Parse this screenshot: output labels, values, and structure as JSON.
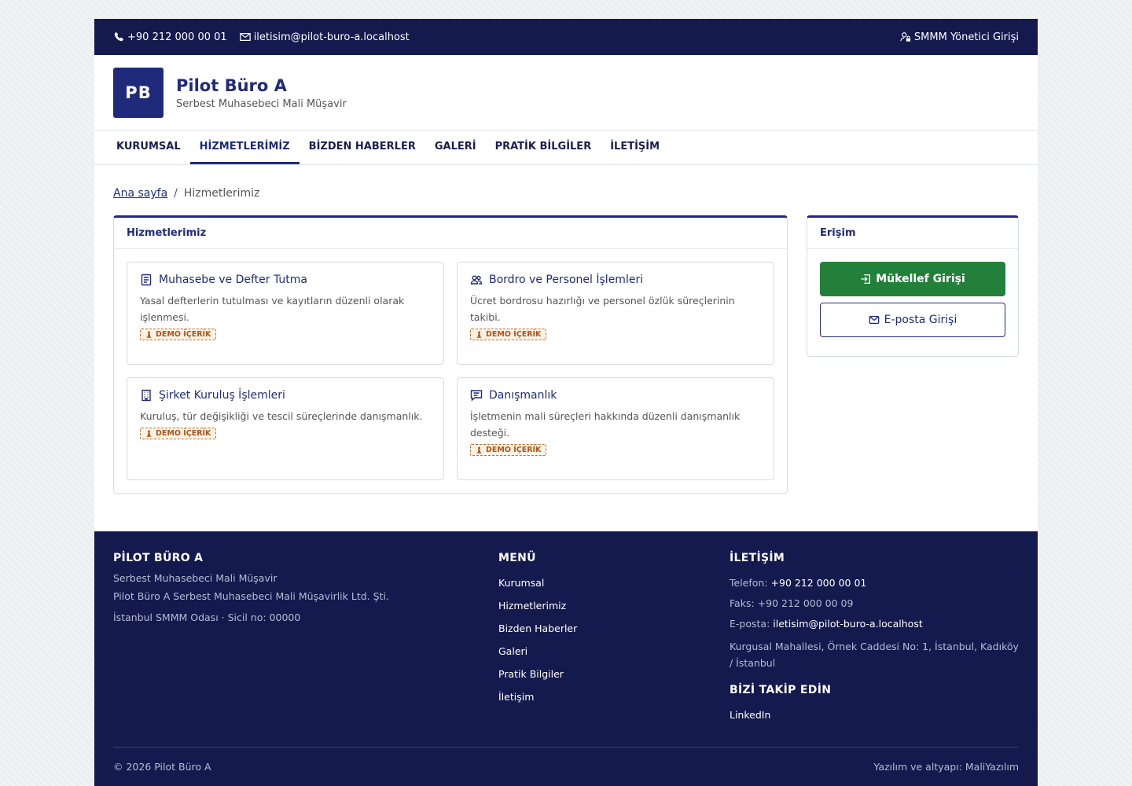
{
  "topbar": {
    "phone": "+90 212 000 00 01",
    "email": "iletisim@pilot-buro-a.localhost",
    "admin_login": "SMMM Yönetici Girişi"
  },
  "header": {
    "logo": "PB",
    "name": "Pilot Büro A",
    "subtitle": "Serbest Muhasebeci Mali Müşavir"
  },
  "nav": {
    "items": [
      {
        "label": "KURUMSAL"
      },
      {
        "label": "HİZMETLERİMİZ",
        "active": true
      },
      {
        "label": "BİZDEN HABERLER"
      },
      {
        "label": "GALERİ"
      },
      {
        "label": "PRATİK BİLGİLER"
      },
      {
        "label": "İLETİŞİM"
      }
    ]
  },
  "breadcrumb": {
    "home": "Ana sayfa",
    "separator": "/",
    "current": "Hizmetlerimiz"
  },
  "services": {
    "title": "Hizmetlerimiz",
    "demo_label": "DEMO İÇERİK",
    "cards": [
      {
        "icon": "ledger-icon",
        "title": "Muhasebe ve Defter Tutma",
        "desc": "Yasal defterlerin tutulması ve kayıtların düzenli olarak işlenmesi."
      },
      {
        "icon": "people-icon",
        "title": "Bordro ve Personel İşlemleri",
        "desc": "Ücret bordrosu hazırlığı ve personel özlük süreçlerinin takibi."
      },
      {
        "icon": "building-icon",
        "title": "Şirket Kuruluş İşlemleri",
        "desc": "Kuruluş, tür değişikliği ve tescil süreçlerinde danışmanlık."
      },
      {
        "icon": "chat-icon",
        "title": "Danışmanlık",
        "desc": "İşletmenin mali süreçleri hakkında düzenli danışmanlık desteği."
      }
    ]
  },
  "access": {
    "title": "Erişim",
    "primary": "Mükellef Girişi",
    "secondary": "E-posta Girişi"
  },
  "footer": {
    "brand_title": "PİLOT BÜRO A",
    "brand_sub": "Serbest Muhasebeci Mali Müşavir",
    "company": "Pilot Büro A Serbest Muhasebeci Mali Müşavirlik Ltd. Şti.",
    "chamber": "İstanbul SMMM Odası · Sicil no: 00000",
    "menu_title": "MENÜ",
    "menu": [
      "Kurumsal",
      "Hizmetlerimiz",
      "Bizden Haberler",
      "Galeri",
      "Pratik Bilgiler",
      "İletişim"
    ],
    "contact_title": "İLETİŞİM",
    "phone_label": "Telefon:",
    "phone": "+90 212 000 00 01",
    "fax": "Faks: +90 212 000 00 09",
    "email_label": "E-posta:",
    "email": "iletisim@pilot-buro-a.localhost",
    "address": "Kurgusal Mahallesi, Örnek Caddesi No: 1, İstanbul, Kadıköy / İstanbul",
    "follow_title": "BİZİ TAKİP EDİN",
    "linkedin": "LinkedIn",
    "copyright": "© 2026 Pilot Büro A",
    "powered": "Yazılım ve altyapı: MaliYazılım"
  }
}
